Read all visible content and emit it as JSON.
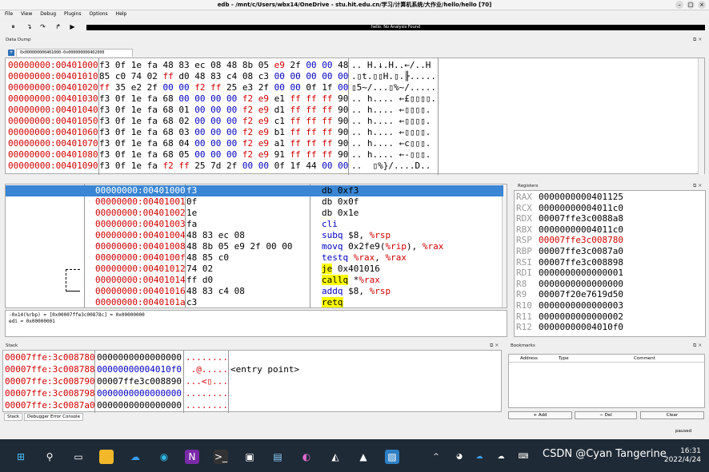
{
  "window": {
    "title": "edb - /mnt/c/Users/wbx14/OneDrive - stu.hit.edu.cn/学习/计算机系统/大作业/hello/hello [70]"
  },
  "menu": [
    "File",
    "View",
    "Debug",
    "Plugins",
    "Options",
    "Help"
  ],
  "status_banner": "hello: No Analysis Found",
  "data_dump": {
    "title": "Data Dump",
    "tab": "0x000000000401000-0x000000000402000",
    "rows": [
      {
        "addr": "00000000:00401000",
        "hex": "f3 0f 1e fa 48 83 ec 08 48 8b 05 e9 2f 00 00 48",
        "ascii": ".. H.↓.H..←/..H"
      },
      {
        "addr": "00000000:00401010",
        "hex": "85 c0 74 02 ff d0 48 83 c4 08 c3 00 00 00 00 00",
        "ascii": ".▯t.▯▯H.▯.╟....."
      },
      {
        "addr": "00000000:00401020",
        "hex": "ff 35 e2 2f 00 00 f2 ff 25 e3 2f 00 00 0f 1f 00",
        "ascii": "▯5~/...▯%~/....."
      },
      {
        "addr": "00000000:00401030",
        "hex": "f3 0f 1e fa 68 00 00 00 00 f2 e9 e1 ff ff ff 90",
        "ascii": ".. h.... ←£▯▯▯▯."
      },
      {
        "addr": "00000000:00401040",
        "hex": "f3 0f 1e fa 68 01 00 00 00 f2 e9 d1 ff ff ff 90",
        "ascii": ".. h.... ←▯▯▯▯."
      },
      {
        "addr": "00000000:00401050",
        "hex": "f3 0f 1e fa 68 02 00 00 00 f2 e9 c1 ff ff ff 90",
        "ascii": ".. h.... ←▯▯▯▯."
      },
      {
        "addr": "00000000:00401060",
        "hex": "f3 0f 1e fa 68 03 00 00 00 f2 e9 b1 ff ff ff 90",
        "ascii": ".. h.... ←▯▯▯▯."
      },
      {
        "addr": "00000000:00401070",
        "hex": "f3 0f 1e fa 68 04 00 00 00 f2 e9 a1 ff ff ff 90",
        "ascii": ".. h.... ←c▯▯▯."
      },
      {
        "addr": "00000000:00401080",
        "hex": "f3 0f 1e fa 68 05 00 00 00 f2 e9 91 ff ff ff 90",
        "ascii": ".. h.... ←-▯▯▯."
      },
      {
        "addr": "00000000:00401090",
        "hex": "f3 0f 1e fa f2 ff 25 7d 2f 00 00 0f 1f 44 00 00",
        "ascii": "..  ▯%}/....D.."
      }
    ]
  },
  "disasm": {
    "rows": [
      {
        "addr": "00000000:00401000",
        "bytes": "f3",
        "instr": "db 0xf3",
        "sel": true
      },
      {
        "addr": "00000000:00401001",
        "bytes": "0f",
        "instr": "db 0x0f"
      },
      {
        "addr": "00000000:00401002",
        "bytes": "1e",
        "instr": "db 0x1e"
      },
      {
        "addr": "00000000:00401003",
        "bytes": "fa",
        "instr": "cli"
      },
      {
        "addr": "00000000:00401004",
        "bytes": "48 83 ec 08",
        "instr": "subq $8, %rsp"
      },
      {
        "addr": "00000000:00401008",
        "bytes": "48 8b 05 e9 2f 00 00",
        "instr": "movq 0x2fe9(%rip), %rax"
      },
      {
        "addr": "00000000:0040100f",
        "bytes": "48 85 c0",
        "instr": "testq %rax, %rax"
      },
      {
        "addr": "00000000:00401012",
        "bytes": "74 02",
        "instr": "je 0x401016"
      },
      {
        "addr": "00000000:00401014",
        "bytes": "ff d0",
        "instr": "callq *%rax"
      },
      {
        "addr": "00000000:00401016",
        "bytes": "48 83 c4 08",
        "instr": "addq $8, %rsp"
      },
      {
        "addr": "00000000:0040101a",
        "bytes": "c3",
        "instr": "retq"
      }
    ],
    "comment_line1": "-0x14(%rbp) = [0x00007ffe3c00878c] = 0x00000000",
    "comment_line2": "edi = 0x00000001"
  },
  "registers": {
    "title": "Registers",
    "rows": [
      {
        "name": "RAX",
        "val": "0000000000401125"
      },
      {
        "name": "RCX",
        "val": "00000000004011c0"
      },
      {
        "name": "RDX",
        "val": "00007ffe3c0088a8"
      },
      {
        "name": "RBX",
        "val": "00000000004011c0"
      },
      {
        "name": "RSP",
        "val": "00007ffe3c008780",
        "changed": true
      },
      {
        "name": "RBP",
        "val": "00007ffe3c0087a0"
      },
      {
        "name": "RSI",
        "val": "00007ffe3c008898"
      },
      {
        "name": "RDI",
        "val": "0000000000000001"
      },
      {
        "name": "R8",
        "val": "0000000000000000"
      },
      {
        "name": "R9",
        "val": "00007f20e7619d50"
      },
      {
        "name": "R10",
        "val": "0000000000000003"
      },
      {
        "name": "R11",
        "val": "0000000000000002"
      },
      {
        "name": "R12",
        "val": "00000000004010f0"
      }
    ]
  },
  "stack": {
    "title": "Stack",
    "rows": [
      {
        "addr": "00007ffe:3c008780",
        "val": "0000000000000000",
        "ascii": "........",
        "comment": ""
      },
      {
        "addr": "00007ffe:3c008788",
        "val": "00000000004010f0",
        "ascii": " .@.....",
        "comment": "<entry point>",
        "blue": true
      },
      {
        "addr": "00007ffe:3c008790",
        "val": "00007ffe3c008890",
        "ascii": "...<▯...",
        "comment": ""
      },
      {
        "addr": "00007ffe:3c008798",
        "val": "0000000000000000",
        "ascii": "........",
        "comment": "",
        "blue": true
      },
      {
        "addr": "00007ffe:3c0087a0",
        "val": "0000000000000000",
        "ascii": "........",
        "comment": ""
      }
    ],
    "tabs": [
      "Stack",
      "Debugger Error Console"
    ]
  },
  "bookmarks": {
    "title": "Bookmarks",
    "columns": [
      "Address",
      "Type",
      "Comment"
    ],
    "add": "+ Add",
    "del": "− Del",
    "clear": "Clear",
    "status": "paused"
  },
  "taskbar": {
    "time": "16:31",
    "date": "2022/4/24",
    "watermark": "CSDN @Cyan Tangerine"
  }
}
